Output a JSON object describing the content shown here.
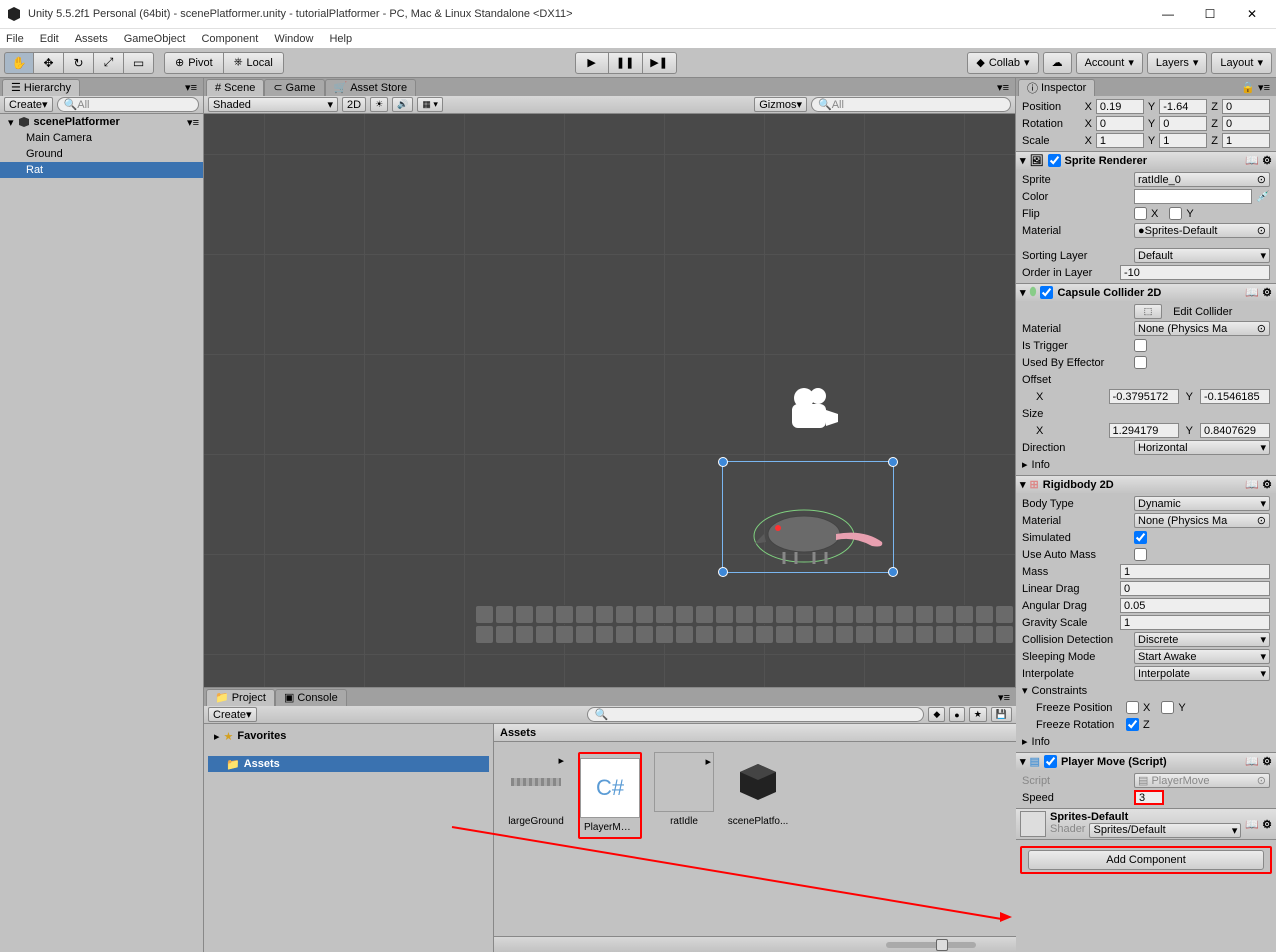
{
  "window": {
    "title": "Unity 5.5.2f1 Personal (64bit) - scenePlatformer.unity - tutorialPlatformer - PC, Mac & Linux Standalone <DX11>"
  },
  "menu": [
    "File",
    "Edit",
    "Assets",
    "GameObject",
    "Component",
    "Window",
    "Help"
  ],
  "toolbar": {
    "pivot": "Pivot",
    "local": "Local",
    "collab": "Collab",
    "account": "Account",
    "layers": "Layers",
    "layout": "Layout"
  },
  "hierarchy": {
    "title": "Hierarchy",
    "create": "Create",
    "searchPlaceholder": "All",
    "scene": "scenePlatformer",
    "items": [
      "Main Camera",
      "Ground",
      "Rat"
    ],
    "selected": "Rat"
  },
  "sceneView": {
    "tabs": [
      "Scene",
      "Game",
      "Asset Store"
    ],
    "shaded": "Shaded",
    "mode2D": "2D",
    "gizmos": "Gizmos",
    "searchPlaceholder": "All"
  },
  "project": {
    "title": "Project",
    "consoleTab": "Console",
    "create": "Create",
    "favorites": "Favorites",
    "assets": "Assets",
    "breadcrumb": "Assets",
    "items": [
      "largeGround",
      "PlayerMove",
      "ratIdle",
      "scenePlatfo..."
    ]
  },
  "inspector": {
    "title": "Inspector",
    "transform": {
      "position": {
        "label": "Position",
        "x": "0.19",
        "y": "-1.64",
        "z": "0"
      },
      "rotation": {
        "label": "Rotation",
        "x": "0",
        "y": "0",
        "z": "0"
      },
      "scale": {
        "label": "Scale",
        "x": "1",
        "y": "1",
        "z": "1"
      }
    },
    "spriteRenderer": {
      "title": "Sprite Renderer",
      "sprite": {
        "label": "Sprite",
        "value": "ratIdle_0"
      },
      "color": {
        "label": "Color"
      },
      "flip": {
        "label": "Flip",
        "x": "X",
        "y": "Y"
      },
      "material": {
        "label": "Material",
        "value": "Sprites-Default"
      },
      "sortingLayer": {
        "label": "Sorting Layer",
        "value": "Default"
      },
      "orderInLayer": {
        "label": "Order in Layer",
        "value": "-10"
      }
    },
    "capsuleCollider": {
      "title": "Capsule Collider 2D",
      "editCollider": "Edit Collider",
      "material": {
        "label": "Material",
        "value": "None (Physics Ma"
      },
      "isTrigger": {
        "label": "Is Trigger"
      },
      "usedByEffector": {
        "label": "Used By Effector"
      },
      "offset": {
        "label": "Offset",
        "x": "-0.3795172",
        "y": "-0.1546185"
      },
      "size": {
        "label": "Size",
        "x": "1.294179",
        "y": "0.8407629"
      },
      "direction": {
        "label": "Direction",
        "value": "Horizontal"
      },
      "info": "Info"
    },
    "rigidbody": {
      "title": "Rigidbody 2D",
      "bodyType": {
        "label": "Body Type",
        "value": "Dynamic"
      },
      "material": {
        "label": "Material",
        "value": "None (Physics Ma"
      },
      "simulated": {
        "label": "Simulated",
        "checked": true
      },
      "useAutoMass": {
        "label": "Use Auto Mass",
        "checked": false
      },
      "mass": {
        "label": "Mass",
        "value": "1"
      },
      "linearDrag": {
        "label": "Linear Drag",
        "value": "0"
      },
      "angularDrag": {
        "label": "Angular Drag",
        "value": "0.05"
      },
      "gravityScale": {
        "label": "Gravity Scale",
        "value": "1"
      },
      "collisionDetection": {
        "label": "Collision Detection",
        "value": "Discrete"
      },
      "sleepingMode": {
        "label": "Sleeping Mode",
        "value": "Start Awake"
      },
      "interpolate": {
        "label": "Interpolate",
        "value": "Interpolate"
      },
      "constraints": {
        "label": "Constraints"
      },
      "freezePosition": {
        "label": "Freeze Position",
        "x": "X",
        "y": "Y"
      },
      "freezeRotation": {
        "label": "Freeze Rotation",
        "z": "Z",
        "checked": true
      },
      "info": "Info"
    },
    "playerMove": {
      "title": "Player Move (Script)",
      "script": {
        "label": "Script",
        "value": "PlayerMove"
      },
      "speed": {
        "label": "Speed",
        "value": "3"
      }
    },
    "materialSection": {
      "name": "Sprites-Default",
      "shader": {
        "label": "Shader",
        "value": "Sprites/Default"
      }
    },
    "addComponent": "Add Component"
  }
}
